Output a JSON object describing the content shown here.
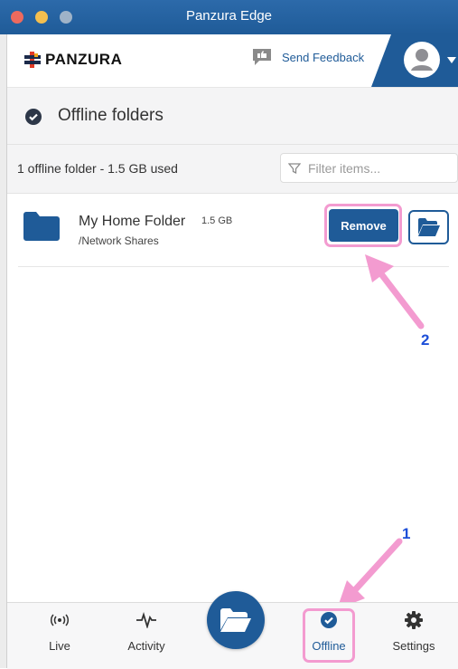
{
  "window": {
    "title": "Panzura Edge"
  },
  "header": {
    "logo_text": "PANZURA",
    "feedback_label": "Send Feedback"
  },
  "page": {
    "title": "Offline folders"
  },
  "toolbar": {
    "summary": "1 offline folder - 1.5 GB used",
    "filter_placeholder": "Filter items..."
  },
  "folders": [
    {
      "name": "My Home Folder",
      "size": "1.5 GB",
      "path": "/Network Shares",
      "remove_label": "Remove"
    }
  ],
  "annotations": {
    "step1": "1",
    "step2": "2"
  },
  "nav": {
    "items": [
      {
        "label": "Live",
        "icon": "live-signal-icon"
      },
      {
        "label": "Activity",
        "icon": "activity-pulse-icon"
      },
      {
        "label": "Offline",
        "icon": "check-circle-icon"
      },
      {
        "label": "Settings",
        "icon": "gear-icon"
      }
    ],
    "center_icon": "open-folder-icon"
  },
  "colors": {
    "brand_blue": "#1f5b98",
    "highlight_pink": "#f39bd0",
    "annotation_blue": "#1d4fd8"
  }
}
